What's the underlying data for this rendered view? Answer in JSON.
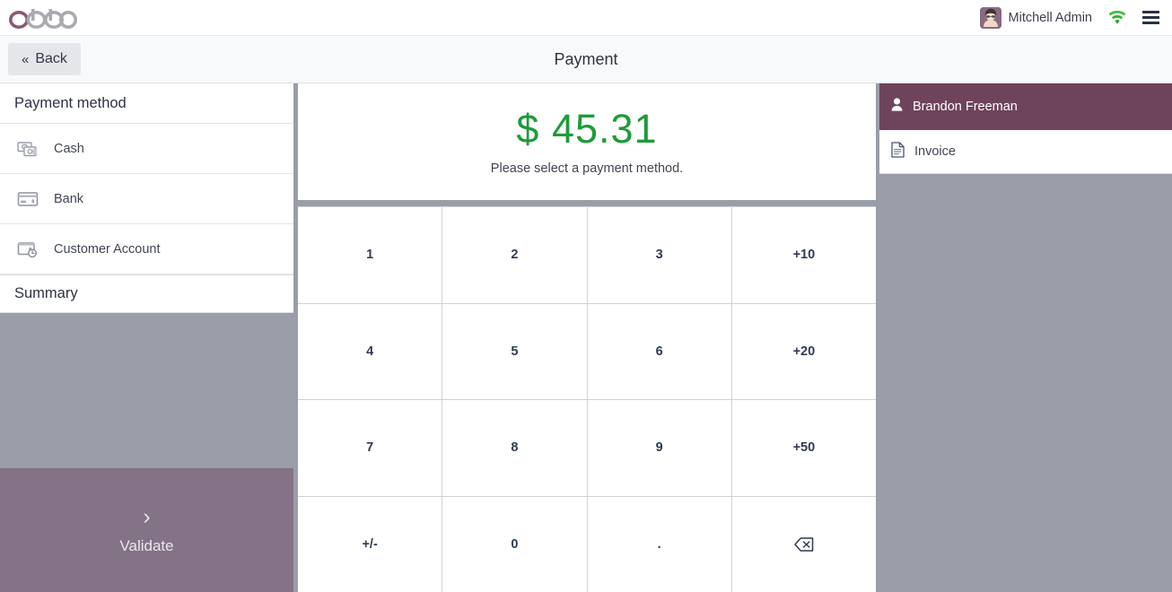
{
  "navbar": {
    "logo_text": "odoo",
    "user_name": "Mitchell Admin",
    "avatar_icon": "user-avatar",
    "wifi_icon": "wifi-icon",
    "menu_icon": "hamburger-menu-icon"
  },
  "subheader": {
    "back_label": "Back",
    "back_chevron": "«",
    "title": "Payment"
  },
  "left_pane": {
    "payment_method_header": "Payment method",
    "methods": [
      {
        "label": "Cash",
        "icon": "cash-icon"
      },
      {
        "label": "Bank",
        "icon": "credit-card-icon"
      },
      {
        "label": "Customer Account",
        "icon": "customer-account-icon"
      }
    ],
    "summary_header": "Summary",
    "validate_label": "Validate",
    "validate_chevron": "›"
  },
  "center_pane": {
    "amount": "$ 45.31",
    "hint": "Please select a payment method.",
    "numpad_keys": [
      {
        "label": "1",
        "name": "numpad-key-1"
      },
      {
        "label": "2",
        "name": "numpad-key-2"
      },
      {
        "label": "3",
        "name": "numpad-key-3"
      },
      {
        "label": "+10",
        "name": "numpad-key-plus10"
      },
      {
        "label": "4",
        "name": "numpad-key-4"
      },
      {
        "label": "5",
        "name": "numpad-key-5"
      },
      {
        "label": "6",
        "name": "numpad-key-6"
      },
      {
        "label": "+20",
        "name": "numpad-key-plus20"
      },
      {
        "label": "7",
        "name": "numpad-key-7"
      },
      {
        "label": "8",
        "name": "numpad-key-8"
      },
      {
        "label": "9",
        "name": "numpad-key-9"
      },
      {
        "label": "+50",
        "name": "numpad-key-plus50"
      },
      {
        "label": "+/-",
        "name": "numpad-key-sign"
      },
      {
        "label": "0",
        "name": "numpad-key-0"
      },
      {
        "label": ".",
        "name": "numpad-key-decimal"
      },
      {
        "label": "",
        "name": "numpad-key-backspace"
      }
    ]
  },
  "right_pane": {
    "customer_name": "Brandon Freeman",
    "customer_icon": "person-icon",
    "invoice_label": "Invoice",
    "invoice_icon": "document-icon"
  },
  "colors": {
    "brand_purple": "#6e445c",
    "validate_purple": "#847287",
    "amount_green": "#1e9b39",
    "panel_gray": "#9a9ea8",
    "key_text": "#2f3b52"
  }
}
